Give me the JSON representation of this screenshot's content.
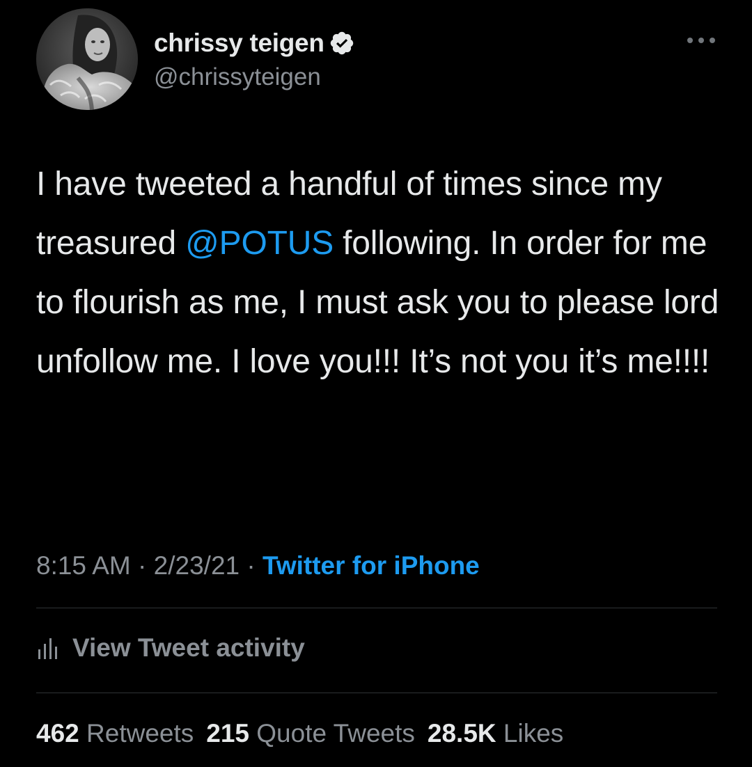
{
  "author": {
    "display_name": "chrissy teigen",
    "handle": "@chrissyteigen",
    "verified": true
  },
  "icons": {
    "verified": "verified-badge-icon",
    "more": "more-options-icon",
    "activity": "bar-chart-icon"
  },
  "tweet": {
    "text_before_mention": "I have tweeted a handful of times since my treasured ",
    "mention": "@POTUS",
    "text_after_mention": " following. In order for me to flourish as me, I must ask you to please lord unfollow me. I love you!!! It’s not you it’s me!!!!"
  },
  "meta": {
    "time": "8:15 AM",
    "separator": "·",
    "date": "2/23/21",
    "source": "Twitter for iPhone"
  },
  "activity": {
    "label": "View Tweet activity"
  },
  "stats": {
    "retweets_count": "462",
    "retweets_label": "Retweets",
    "quotes_count": "215",
    "quotes_label": "Quote Tweets",
    "likes_count": "28.5K",
    "likes_label": "Likes"
  },
  "colors": {
    "background": "#000000",
    "text": "#e7e9ea",
    "secondary": "#8b9096",
    "link": "#1d9bf0",
    "divider": "#2f3336"
  }
}
